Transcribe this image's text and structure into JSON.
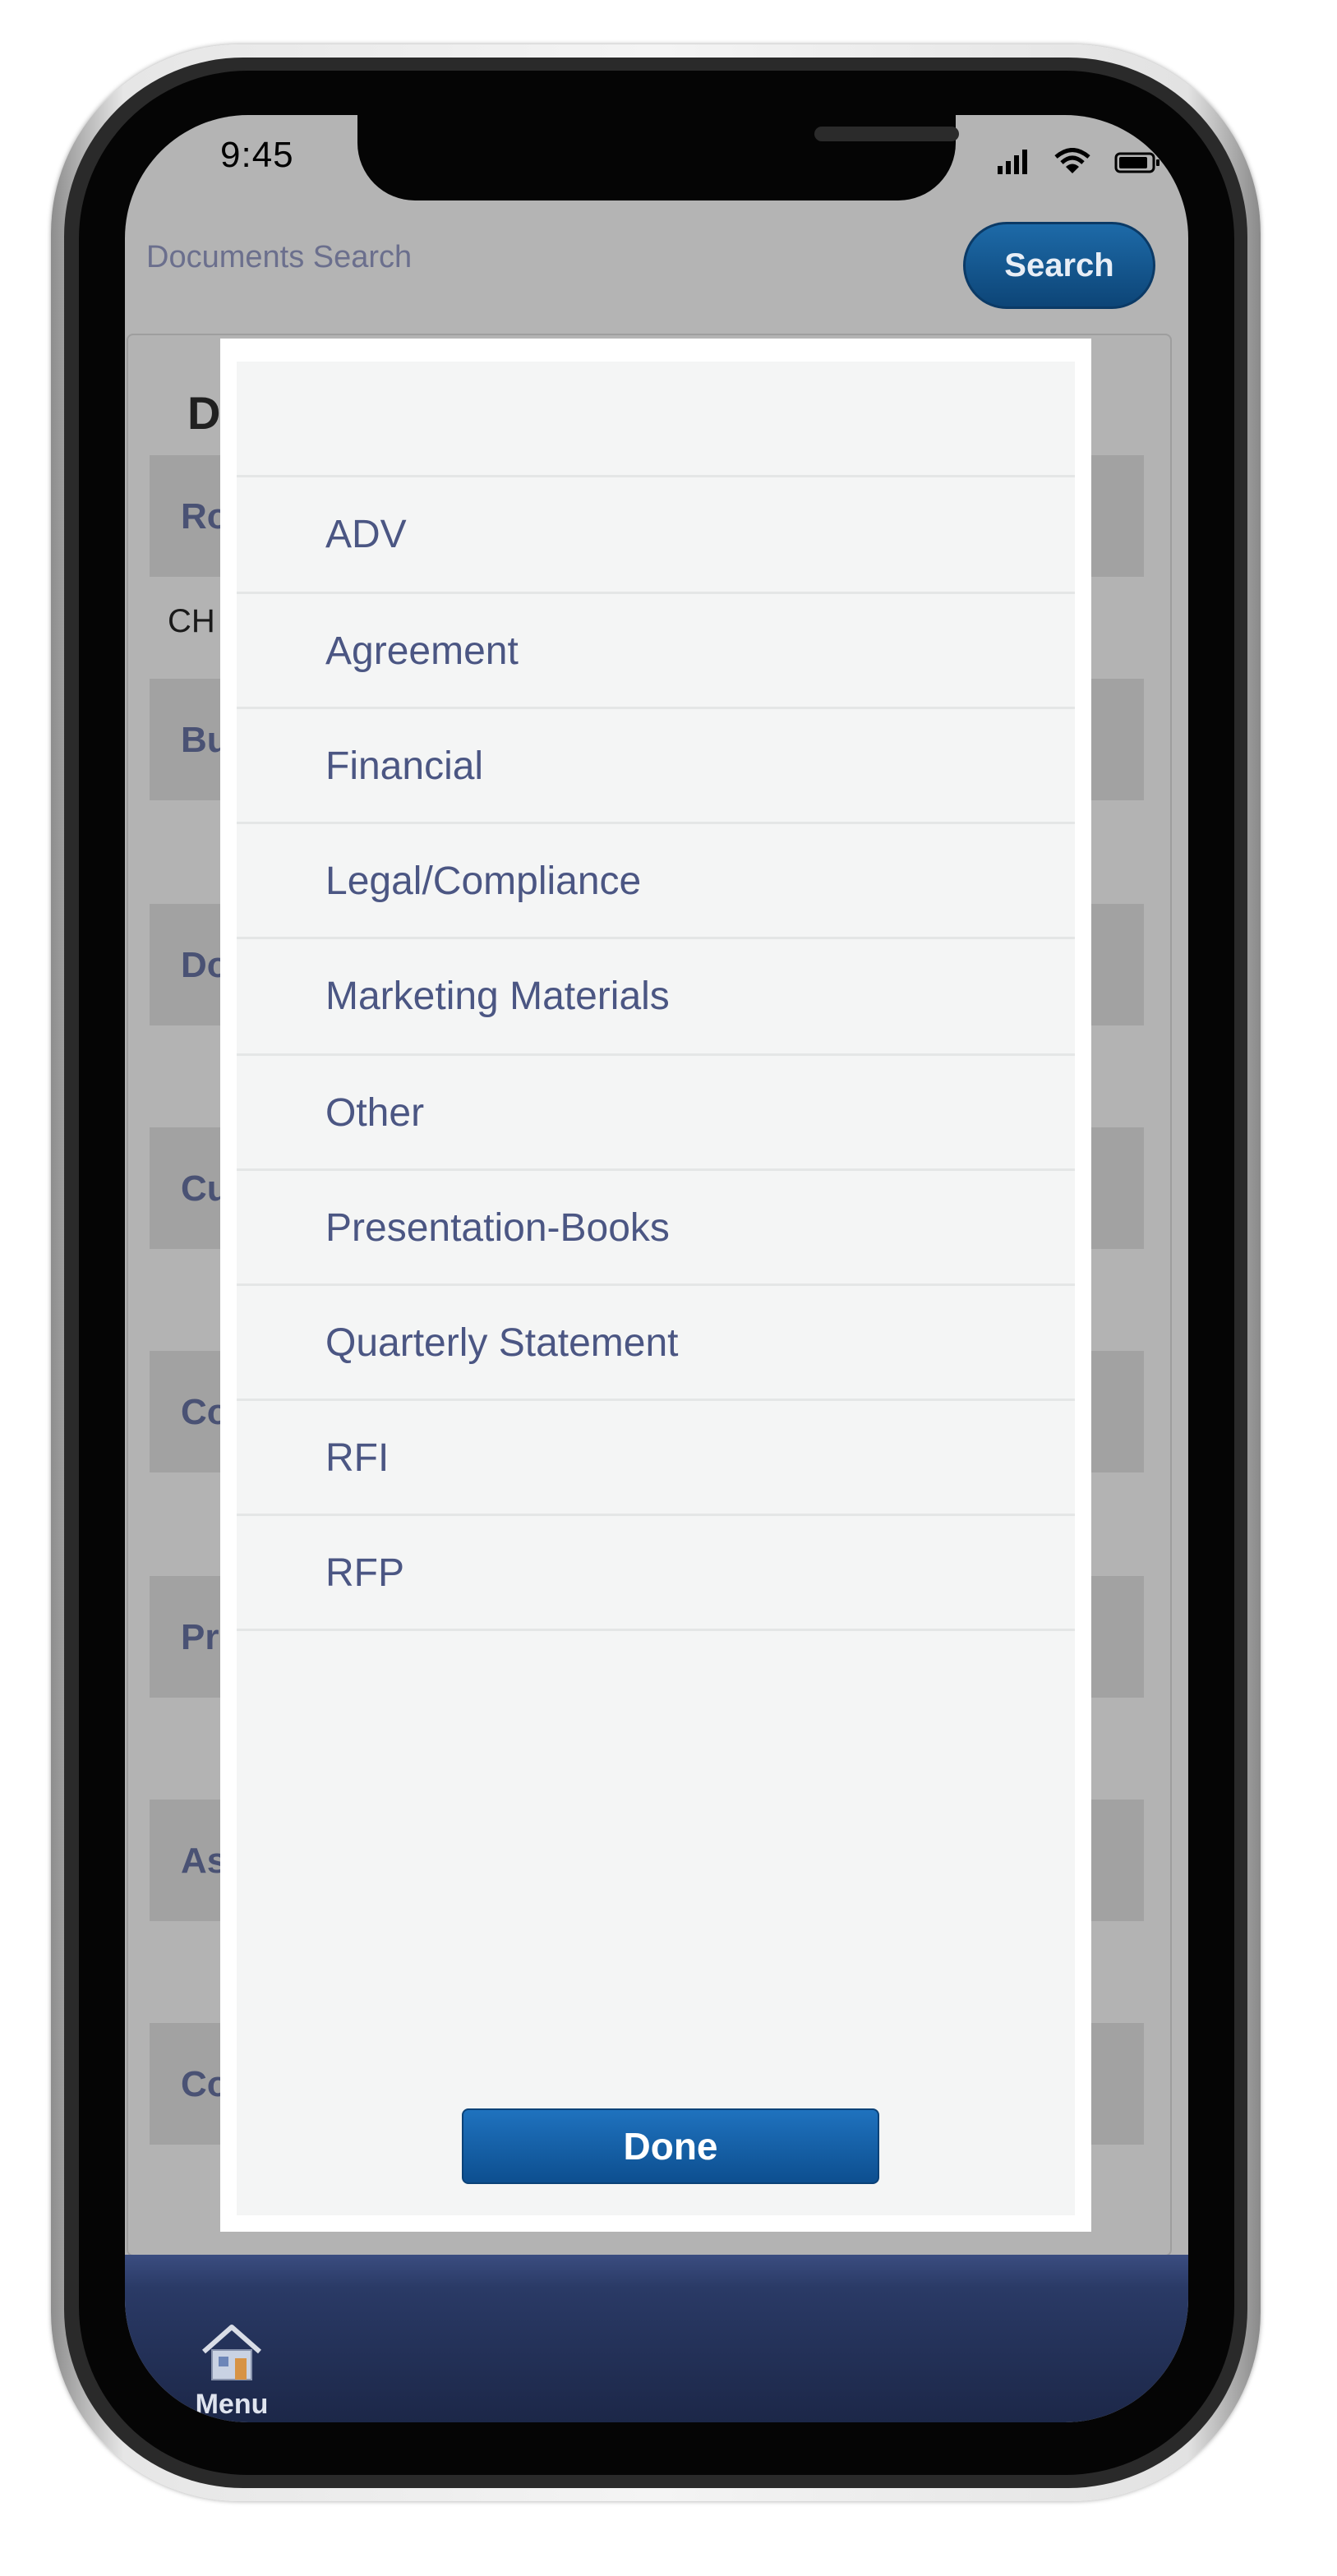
{
  "status_bar": {
    "time": "9:45"
  },
  "header": {
    "title": "Documents Search",
    "search_label": "Search"
  },
  "background": {
    "heading_partial": "D",
    "row_labels": [
      "Ro",
      "Bu",
      "Do",
      "Cu",
      "Co",
      "Pr",
      "As",
      "Co"
    ],
    "value_partial": "CH"
  },
  "picker": {
    "options": [
      "ADV",
      "Agreement",
      "Financial",
      "Legal/Compliance",
      "Marketing Materials",
      "Other",
      "Presentation-Books",
      "Quarterly Statement",
      "RFI",
      "RFP"
    ],
    "done_label": "Done"
  },
  "footer": {
    "menu_label": "Menu"
  }
}
